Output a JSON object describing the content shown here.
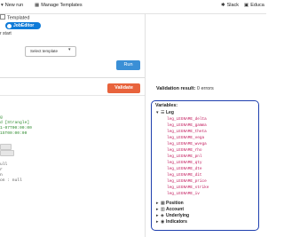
{
  "topbar": {
    "new_run": "New run",
    "manage_templates": "Manage Templates",
    "slack": "Slack",
    "education": "Educa"
  },
  "left": {
    "templated_label": "Templated",
    "toggle_label": "JobEditor",
    "start_label": "r start",
    "select_template_label": "Select template",
    "run_label": "Run",
    "validate_label": "Validate",
    "code_lines": [
      "g",
      "d [Strangle]",
      "1-07T00:00:00",
      "15T00:00:00",
      "",
      "",
      "ull",
      "r",
      "n",
      "on : null"
    ]
  },
  "right": {
    "validation_label": "Validation result:",
    "validation_errors": "0 errors",
    "variables_title": "Variables:",
    "leg_group": "Leg",
    "leg_variables": [
      "leg_LEGNAME_delta",
      "leg_LEGNAME_gamma",
      "leg_LEGNAME_theta",
      "leg_LEGNAME_vega",
      "leg_LEGNAME_wvega",
      "leg_LEGNAME_rho",
      "leg_LEGNAME_pnl",
      "leg_LEGNAME_qty",
      "leg_LEGNAME_dte",
      "leg_LEGNAME_dit",
      "leg_LEGNAME_price",
      "leg_LEGNAME_strike",
      "leg_LEGNAME_iv"
    ],
    "groups": [
      "Position",
      "Account",
      "Underlying",
      "Indicators"
    ]
  }
}
